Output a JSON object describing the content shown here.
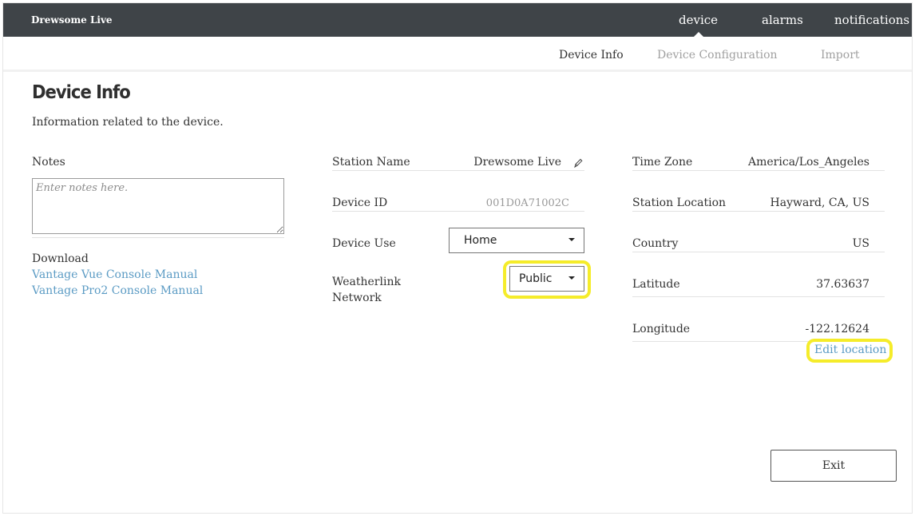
{
  "header": {
    "brand": "Drewsome Live",
    "nav": [
      {
        "label": "device"
      },
      {
        "label": "alarms"
      },
      {
        "label": "notifications"
      }
    ]
  },
  "subnav": {
    "items": [
      {
        "label": "Device Info",
        "active": true
      },
      {
        "label": "Device Configuration",
        "active": false
      },
      {
        "label": "Import",
        "active": false
      }
    ]
  },
  "page": {
    "title": "Device Info",
    "subtitle": "Information related to the device."
  },
  "left": {
    "notes_label": "Notes",
    "notes_placeholder": "Enter notes here.",
    "notes_value": "",
    "download_label": "Download",
    "links": [
      {
        "label": "Vantage Vue Console Manual"
      },
      {
        "label": "Vantage Pro2 Console Manual"
      }
    ]
  },
  "middle": {
    "station_name_label": "Station Name",
    "station_name_value": "Drewsome Live",
    "device_id_label": "Device ID",
    "device_id_value": "001D0A71002C",
    "device_use_label": "Device Use",
    "device_use_value": "Home",
    "network_label_1": "Weatherlink",
    "network_label_2": "Network",
    "network_value": "Public"
  },
  "right": {
    "time_zone_label": "Time Zone",
    "time_zone_value": "America/Los_Angeles",
    "station_location_label": "Station Location",
    "station_location_value": "Hayward, CA, US",
    "country_label": "Country",
    "country_value": "US",
    "latitude_label": "Latitude",
    "latitude_value": "37.63637",
    "longitude_label": "Longitude",
    "longitude_value": "-122.12624",
    "edit_location_label": "Edit location"
  },
  "footer": {
    "exit_label": "Exit"
  },
  "colors": {
    "topbar": "#3f4448",
    "link": "#5b9bc4",
    "highlight": "#f5ec2a"
  }
}
